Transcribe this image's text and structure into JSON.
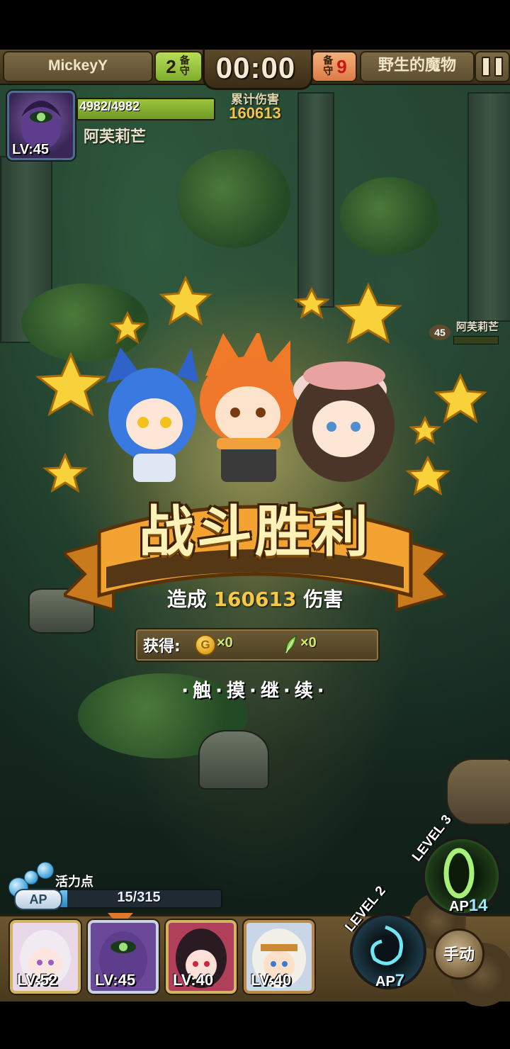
{
  "hud": {
    "player_name": "MickeyY",
    "left_reserve": {
      "count": "2",
      "label": "备守"
    },
    "timer": "00:00",
    "right_reserve": {
      "count": "9",
      "label": "备守"
    },
    "enemy_name": "野生的魔物",
    "accumulated_damage_label": "累计伤害",
    "accumulated_damage": "160613"
  },
  "active_character": {
    "hp_text": "4982/4982",
    "hp_fraction": 1.0,
    "name": "阿芙莉芒",
    "level": "LV:45"
  },
  "enemy_unit": {
    "level": "45",
    "name": "阿芙莉芒"
  },
  "victory": {
    "title": "战斗胜利",
    "dealt_prefix": "造成",
    "damage": "160613",
    "dealt_suffix": "伤害",
    "reward_label": "获得:",
    "coin_symbol": "G",
    "coins": "×0",
    "feathers": "×0",
    "continue_text": "·触·摸·继·续·"
  },
  "energy": {
    "label": "活力点",
    "badge": "AP",
    "value": "15/315",
    "fraction": 0.048
  },
  "team": [
    {
      "level": "LV:52",
      "color": "#e8d8e8",
      "icon": "white-hair-girl-portrait"
    },
    {
      "level": "LV:45",
      "color": "#6a4a98",
      "icon": "purple-hair-portrait",
      "selected": true
    },
    {
      "level": "LV:40",
      "color": "#b0405a",
      "icon": "black-hair-girl-portrait"
    },
    {
      "level": "LV:40",
      "color": "#c9d6e8",
      "icon": "hooded-boy-portrait"
    }
  ],
  "skills": {
    "skill1": {
      "level": "LEVEL 2",
      "ap_label": "AP",
      "ap": "7",
      "color": "#2bd0e6"
    },
    "skill2": {
      "level": "LEVEL 3",
      "ap_label": "AP",
      "ap": "14",
      "color": "#58d23a"
    },
    "manual_label": "手动"
  },
  "colors": {
    "accent_gold": "#f7c844",
    "hp_green": "#8ab83a",
    "ap_blue": "#3b9ad6"
  }
}
